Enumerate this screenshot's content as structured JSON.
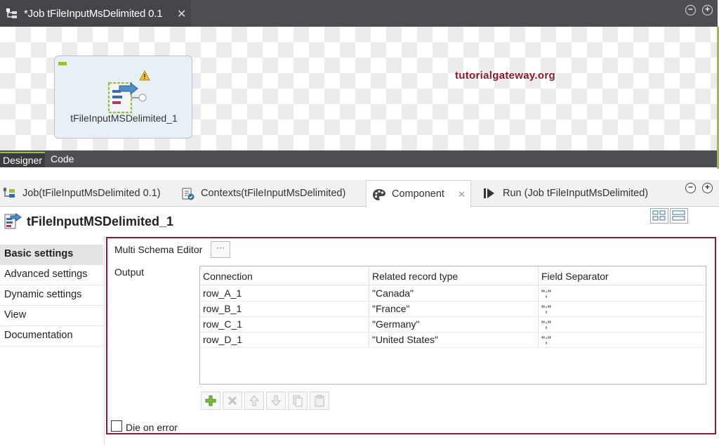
{
  "job_editor": {
    "tab_title": "*Job tFileInputMsDelimited 0.1",
    "close_glyph": "✕",
    "minimize_glyph": "−",
    "maximize_glyph": "+",
    "component_label": "tFileInputMSDelimited_1",
    "watermark": "tutorialgateway.org",
    "bottom_tabs": [
      "Designer",
      "Code"
    ]
  },
  "panel_tabs": [
    {
      "label": "Job(tFileInputMsDelimited 0.1)",
      "icon": "job-icon"
    },
    {
      "label": "Contexts(tFileInputMsDelimited)",
      "icon": "contexts-icon"
    },
    {
      "label": "Component",
      "icon": "palette-icon",
      "active": true
    },
    {
      "label": "Run (Job tFileInputMsDelimited)",
      "icon": "run-icon"
    }
  ],
  "component": {
    "title": "tFileInputMSDelimited_1"
  },
  "sidenav": [
    "Basic settings",
    "Advanced settings",
    "Dynamic settings",
    "View",
    "Documentation"
  ],
  "settings": {
    "multi_schema_label": "Multi Schema Editor",
    "multi_schema_button": "···",
    "output_label": "Output",
    "table": {
      "columns": [
        "Connection",
        "Related record type",
        "Field Separator"
      ],
      "rows": [
        [
          "row_A_1",
          "\"Canada\"",
          "\";\""
        ],
        [
          "row_B_1",
          "\"France\"",
          "\";\""
        ],
        [
          "row_C_1",
          "\"Germany\"",
          "\";\""
        ],
        [
          "row_D_1",
          "\"United States\"",
          "\";\""
        ]
      ]
    },
    "toolbar_icons": [
      "add-icon",
      "delete-icon",
      "move-up-icon",
      "move-down-icon",
      "copy-icon",
      "paste-icon"
    ],
    "die_on_error_label": "Die on error",
    "die_on_error_checked": false
  },
  "colors": {
    "highlight": "#8b1a3a",
    "accent_green": "#9cc034",
    "dark_bar": "#4d4f52"
  }
}
